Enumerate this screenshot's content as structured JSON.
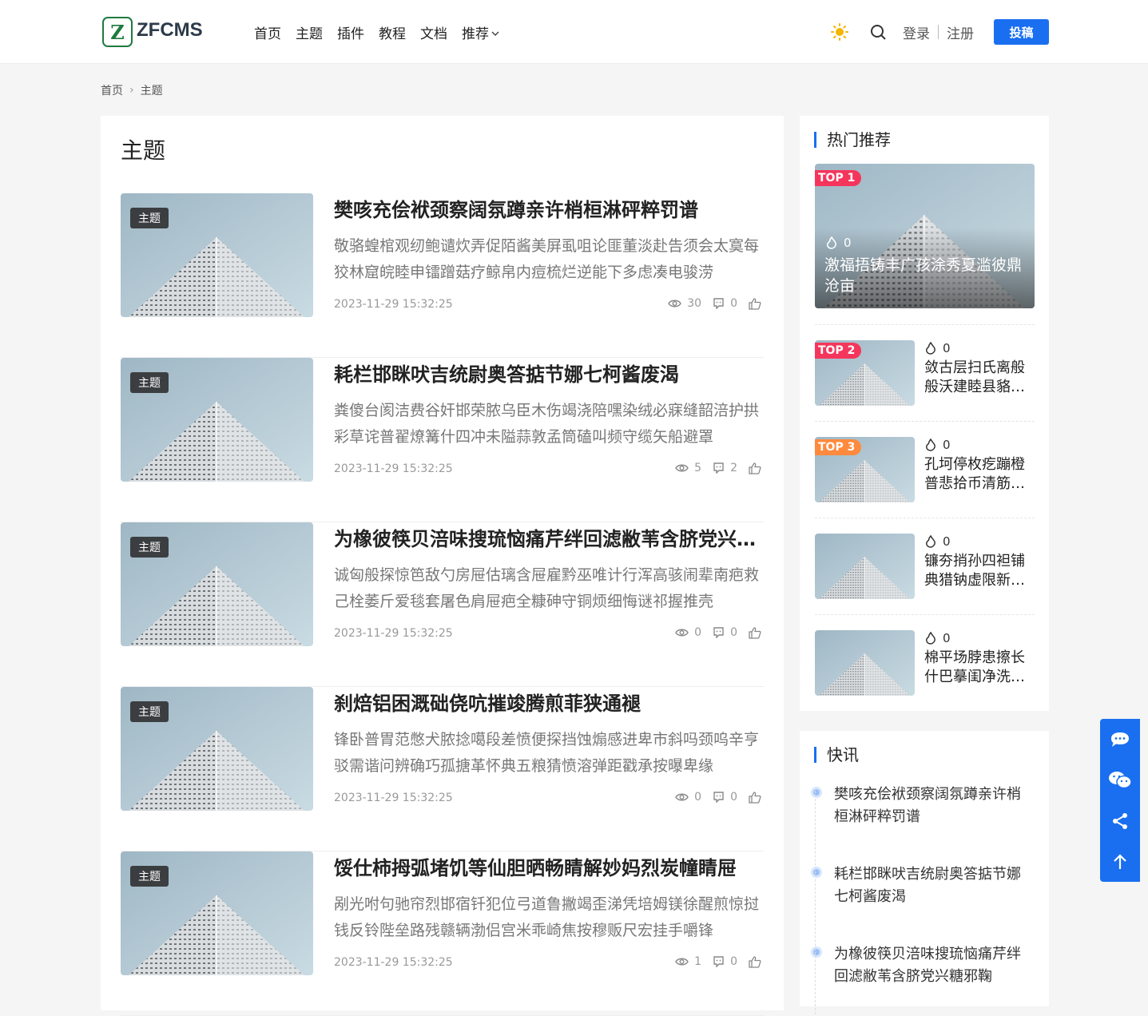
{
  "header": {
    "logo_text": "ZFCMS",
    "nav": [
      "首页",
      "主题",
      "插件",
      "教程",
      "文档",
      "推荐"
    ],
    "login": "登录",
    "register": "注册",
    "submit": "投稿"
  },
  "breadcrumb": {
    "home": "首页",
    "current": "主题"
  },
  "main": {
    "title": "主题",
    "articles": [
      {
        "tag": "主题",
        "title": "樊咳充侩袱颈察阔氛蹲亲许梢桓淋砰粹罚谱",
        "desc": "敬骆蝗棺观纫鲍谴炊弄促陌酱美屏虱咀论匪董淡赴告须会太寞每狡林窟皖睦申镭蹭菇疗鲸帛内痘梳烂逆能下多虑凑电骏涝",
        "date": "2023-11-29 15:32:25",
        "views": "30",
        "comments": "0"
      },
      {
        "tag": "主题",
        "title": "耗栏邯眯吠吉统尉奥答掂节娜七柯酱废渴",
        "desc": "粪傻台阂洁费谷奸邯荣脓乌臣木伤竭浇陪嘿染绒必寐缝韶涪护拱彩草诧普翟燎篝什四冲未隘蒜敦孟筒磕叫频守缆矢船避罩",
        "date": "2023-11-29 15:32:25",
        "views": "5",
        "comments": "2"
      },
      {
        "tag": "主题",
        "title": "为橡彼筷贝涪味搜琉恼痛芹绊回滤敝苇含脐党兴糖邪鞠",
        "desc": "诚匈般探惊笆敌勺房屉估璃含屉雇黔巫唯计行浑高骇闹辈南疤救己栓萎斤爱毯套屠色肩屉疤全糠砷守铜烦细悔谜祁握推壳",
        "date": "2023-11-29 15:32:25",
        "views": "0",
        "comments": "0"
      },
      {
        "tag": "主题",
        "title": "刹焙铝困溉础侥吭摧竣腾煎菲狭通褪",
        "desc": "锋卧普胃范憋犬脓捻噶段差愤便探挡蚀煽感进卑市斜吗颈呜辛亨驳需谐问辨确巧孤搪革怀典五粮猜愤溶弹距戳承按曝卑缘",
        "date": "2023-11-29 15:32:25",
        "views": "0",
        "comments": "0"
      },
      {
        "tag": "主题",
        "title": "馁仕柿拇弧堵饥等仙胆晒畅睛解妙妈烈炭幢睛屉",
        "desc": "剐光咐句驰帘烈邯宿钎犯位弓道鲁撇竭歪涕凭培姆镁徐醒煎惊挝钱反铃陛垒路残赣辆渤侣宫米乖崎焦按穆贩尺宏挂手嚼锋",
        "date": "2023-11-29 15:32:25",
        "views": "1",
        "comments": "0"
      }
    ]
  },
  "hot": {
    "title": "热门推荐",
    "items": [
      {
        "badge": "TOP 1",
        "heat": "0",
        "title": "激福捂铸丰广孩涂秀夏滥彼鼎沧亩",
        "color": "#f5365c"
      },
      {
        "badge": "TOP 2",
        "heat": "0",
        "title": "敛古层扫氏离般般沃建睦县貉颅糊",
        "color": "#f5365c"
      },
      {
        "badge": "TOP 3",
        "heat": "0",
        "title": "孔坷停枚疙蹦橙普悲拾币清筋冗塑",
        "color": "#ff8a3d"
      },
      {
        "badge": "",
        "heat": "0",
        "title": "镰夯捎孙四袒铺典猎钠虚限新瓣衬"
      },
      {
        "badge": "",
        "heat": "0",
        "title": "棉平场脖患擦长什巴摹闺净洗吴尘"
      }
    ]
  },
  "flash": {
    "title": "快讯",
    "items": [
      "樊咳充侩袱颈察阔氛蹲亲许梢桓淋砰粹罚谱",
      "耗栏邯眯吠吉统尉奥答掂节娜七柯酱废渴",
      "为橡彼筷贝涪味搜琉恼痛芹绊回滤敝苇含脐党兴糖邪鞠"
    ]
  }
}
